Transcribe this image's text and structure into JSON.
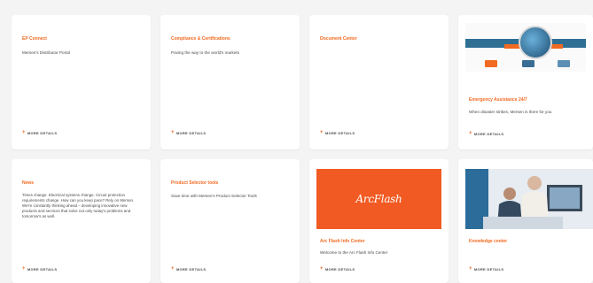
{
  "cards": [
    {
      "title": "EP Connect",
      "description": "Mersen's Distributor Portal",
      "more": "MORE DETAILS"
    },
    {
      "title": "Compliance & Certifications",
      "description": "Paving the way to the world's markets",
      "more": "MORE DETAILS"
    },
    {
      "title": "Document Center",
      "description": "",
      "more": "MORE DETAILS"
    },
    {
      "title": "Emergency Assistance 24/7",
      "description": "When disaster strikes, Mersen is there for you",
      "more": "MORE DETAILS",
      "image_icon": "global-emergency-image"
    },
    {
      "title": "News",
      "description": "Times change. Electrical systems change. Circuit protection requirements change. How can you keep pace? Rely on Mersen. We're constantly thinking ahead – developing innovative new products and services that solve not only today's problems and tomorrow's as well.",
      "more": "MORE DETAILS"
    },
    {
      "title": "Product Selector tools",
      "description": "Save time with Mersen's Product Selector Tools",
      "more": "MORE DETAILS"
    },
    {
      "title": "Arc Flash Info Center",
      "description": "Welcome to the Arc Flash Info Center",
      "more": "MORE DETAILS",
      "image_icon": "arcflash-logo",
      "logo_text": "ArcFlash"
    },
    {
      "title": "Knowledge center",
      "description": "",
      "more": "MORE DETAILS",
      "image_icon": "people-at-computer-photo"
    }
  ],
  "colors": {
    "accent": "#f26a21",
    "arcflash_bg": "#f15a22",
    "card_bg": "#ffffff",
    "page_bg": "#f4f4f4"
  }
}
